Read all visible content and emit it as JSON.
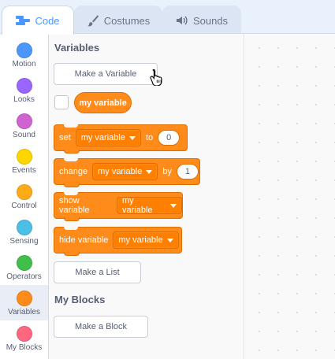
{
  "tabs": {
    "code": "Code",
    "costumes": "Costumes",
    "sounds": "Sounds"
  },
  "categories": [
    {
      "label": "Motion",
      "color": "#4c97ff"
    },
    {
      "label": "Looks",
      "color": "#9966ff"
    },
    {
      "label": "Sound",
      "color": "#cf63cf"
    },
    {
      "label": "Events",
      "color": "#ffd500"
    },
    {
      "label": "Control",
      "color": "#ffab19"
    },
    {
      "label": "Sensing",
      "color": "#4cbfe6"
    },
    {
      "label": "Operators",
      "color": "#40bf4a"
    },
    {
      "label": "Variables",
      "color": "#ff8c1a"
    },
    {
      "label": "My Blocks",
      "color": "#ff6680"
    }
  ],
  "selected_category": "Variables",
  "flyout": {
    "variables_heading": "Variables",
    "make_variable": "Make a Variable",
    "variable_reporter": "my variable",
    "blocks": {
      "set": {
        "label": "set",
        "variable": "my variable",
        "to": "to",
        "value": "0"
      },
      "change": {
        "label": "change",
        "variable": "my variable",
        "by": "by",
        "value": "1"
      },
      "show": {
        "label": "show variable",
        "variable": "my variable"
      },
      "hide": {
        "label": "hide variable",
        "variable": "my variable"
      }
    },
    "make_list": "Make a List",
    "myblocks_heading": "My Blocks",
    "make_block": "Make a Block"
  },
  "colors": {
    "accent": "#4c97ff",
    "variables_block": "#ff8c1a"
  }
}
